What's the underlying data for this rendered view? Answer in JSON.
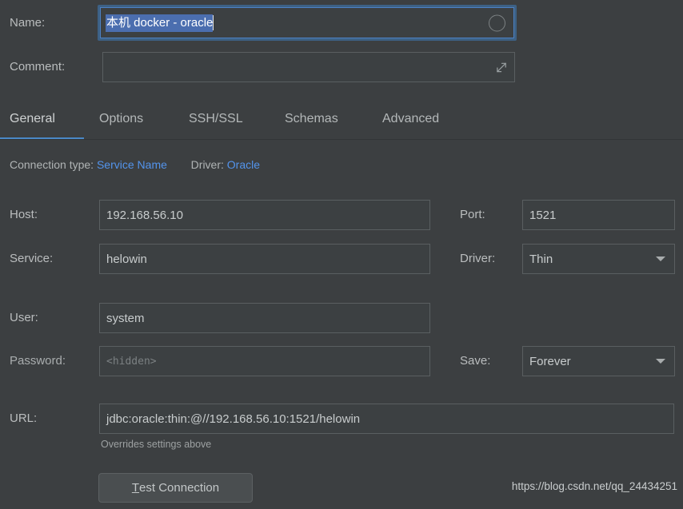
{
  "form": {
    "name": {
      "label": "Name:",
      "value": "本机 docker - oracle",
      "selected": true,
      "icon": "circle-ring-icon"
    },
    "comment": {
      "label": "Comment:",
      "value": "",
      "placeholder": "",
      "icon": "expand-diagonal-icon"
    }
  },
  "tabs": [
    {
      "label": "General",
      "active": true
    },
    {
      "label": "Options",
      "active": false
    },
    {
      "label": "SSH/SSL",
      "active": false
    },
    {
      "label": "Schemas",
      "active": false
    },
    {
      "label": "Advanced",
      "active": false
    }
  ],
  "connection_info": {
    "type_label": "Connection type:",
    "type_value": "Service Name",
    "driver_label": "Driver:",
    "driver_value": "Oracle"
  },
  "general": {
    "host": {
      "label": "Host:",
      "value": "192.168.56.10"
    },
    "port": {
      "label": "Port:",
      "value": "1521"
    },
    "service": {
      "label": "Service:",
      "value": "helowin"
    },
    "driver": {
      "label": "Driver:",
      "value": "Thin"
    },
    "user": {
      "label": "User:",
      "value": "system"
    },
    "password": {
      "label": "Password:",
      "value": "",
      "placeholder": "<hidden>"
    },
    "save": {
      "label": "Save:",
      "value": "Forever"
    },
    "url": {
      "label": "URL:",
      "value": "jdbc:oracle:thin:@//192.168.56.10:1521/helowin",
      "hint": "Overrides settings above"
    }
  },
  "actions": {
    "test_connection": {
      "mnemonic": "T",
      "rest": "est Connection"
    }
  },
  "watermark": "https://blog.csdn.net/qq_24434251",
  "colors": {
    "background": "#3c3f41",
    "field_bg": "#3c4042",
    "field_border": "#5a5f61",
    "label": "#babdbe",
    "link": "#5394ec",
    "tab_active_underline": "#4a88c7",
    "selection": "#4b6eaf",
    "focus_ring": "#4c81c4"
  }
}
